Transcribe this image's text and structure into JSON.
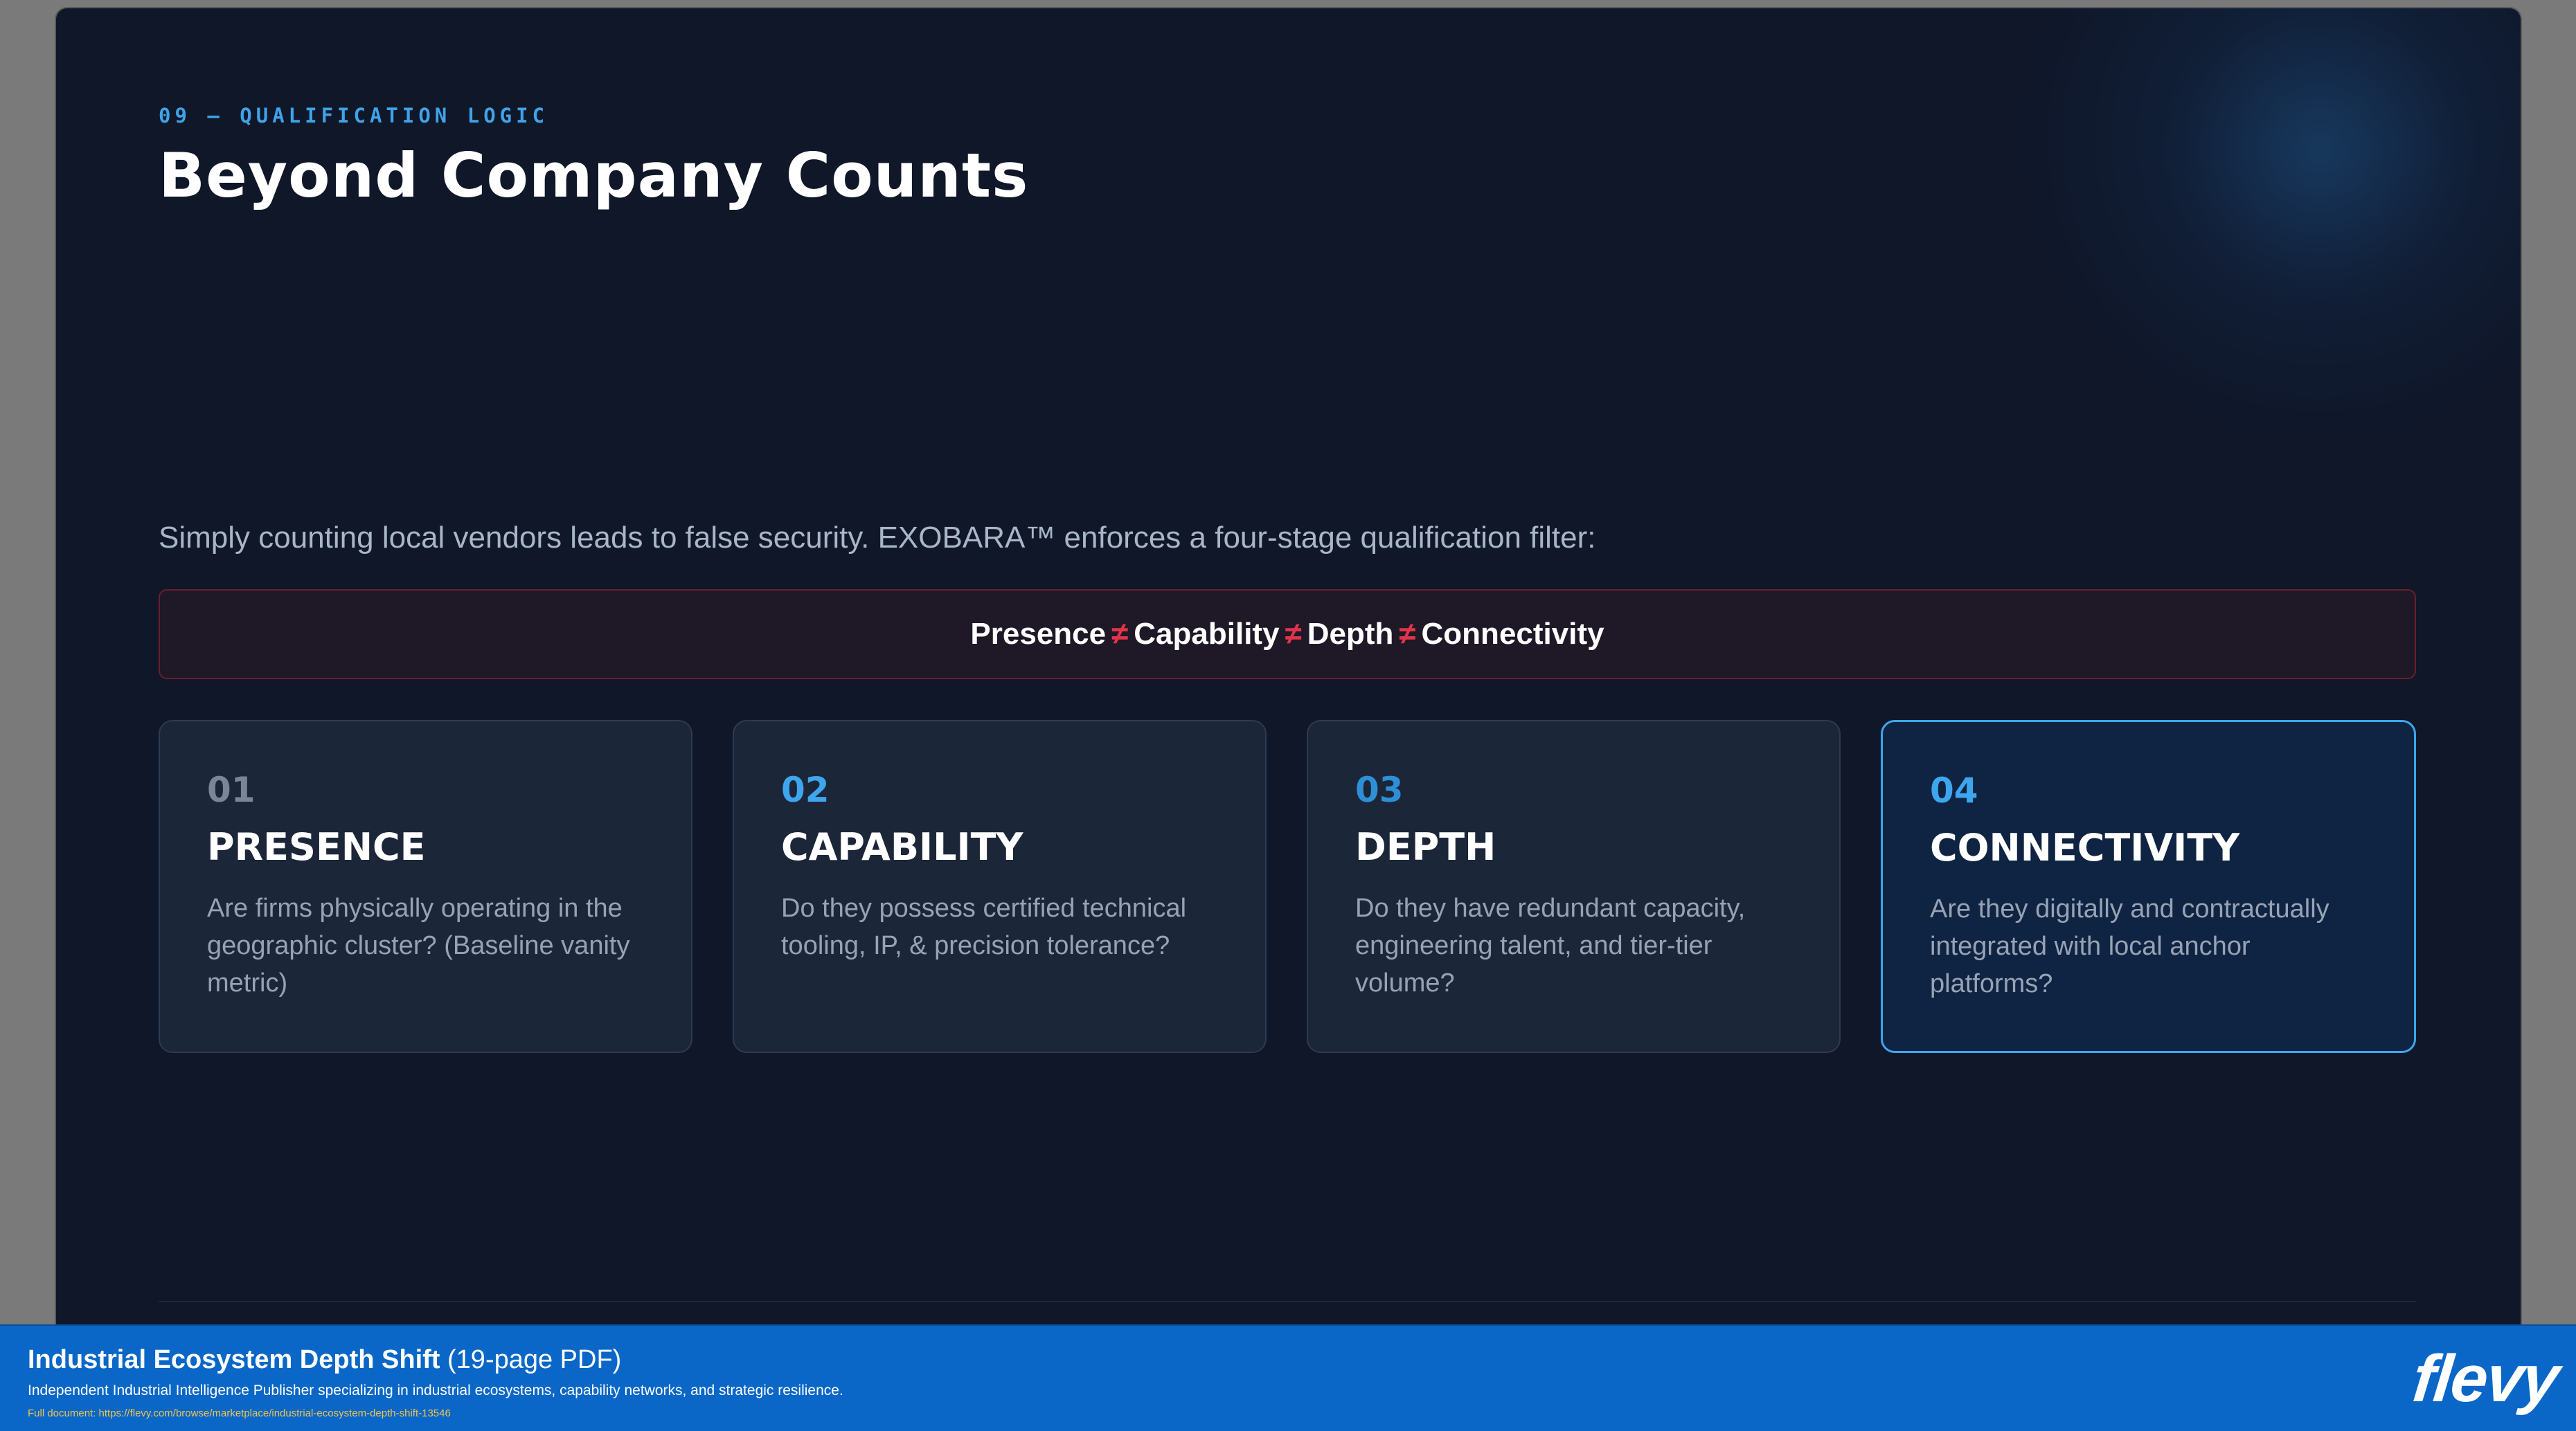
{
  "slide": {
    "kicker": "09 — QUALIFICATION LOGIC",
    "title": "Beyond Company Counts",
    "intro": "Simply counting local vendors leads to false security. EXOBARA™ enforces a four-stage qualification filter:",
    "formula": {
      "terms": [
        "Presence",
        "Capability",
        "Depth",
        "Connectivity"
      ],
      "operator": "≠"
    },
    "cards": [
      {
        "number": "01",
        "title": "PRESENCE",
        "description": "Are firms physically operating in the geographic cluster? (Baseline vanity metric)"
      },
      {
        "number": "02",
        "title": "CAPABILITY",
        "description": "Do they possess certified technical tooling, IP, & precision tolerance?"
      },
      {
        "number": "03",
        "title": "DEPTH",
        "description": "Do they have redundant capacity, engineering talent, and tier-tier volume?"
      },
      {
        "number": "04",
        "title": "CONNECTIVITY",
        "description": "Are they digitally and contractually integrated with local anchor platforms?"
      }
    ]
  },
  "footer": {
    "doc_title": "Industrial Ecosystem Depth Shift",
    "doc_pages": "(19-page PDF)",
    "publisher": "Independent Industrial Intelligence Publisher specializing in industrial ecosystems, capability networks, and strategic resilience.",
    "link": "Full document: https://flevy.com/browse/marketplace/industrial-ecosystem-depth-shift-13546",
    "logo": "flevy"
  },
  "colors": {
    "accent": "#3ea6ee",
    "slide_bg": "#0f1729",
    "not_equal": "#e0344a",
    "footer_bg": "#0a67c7"
  }
}
